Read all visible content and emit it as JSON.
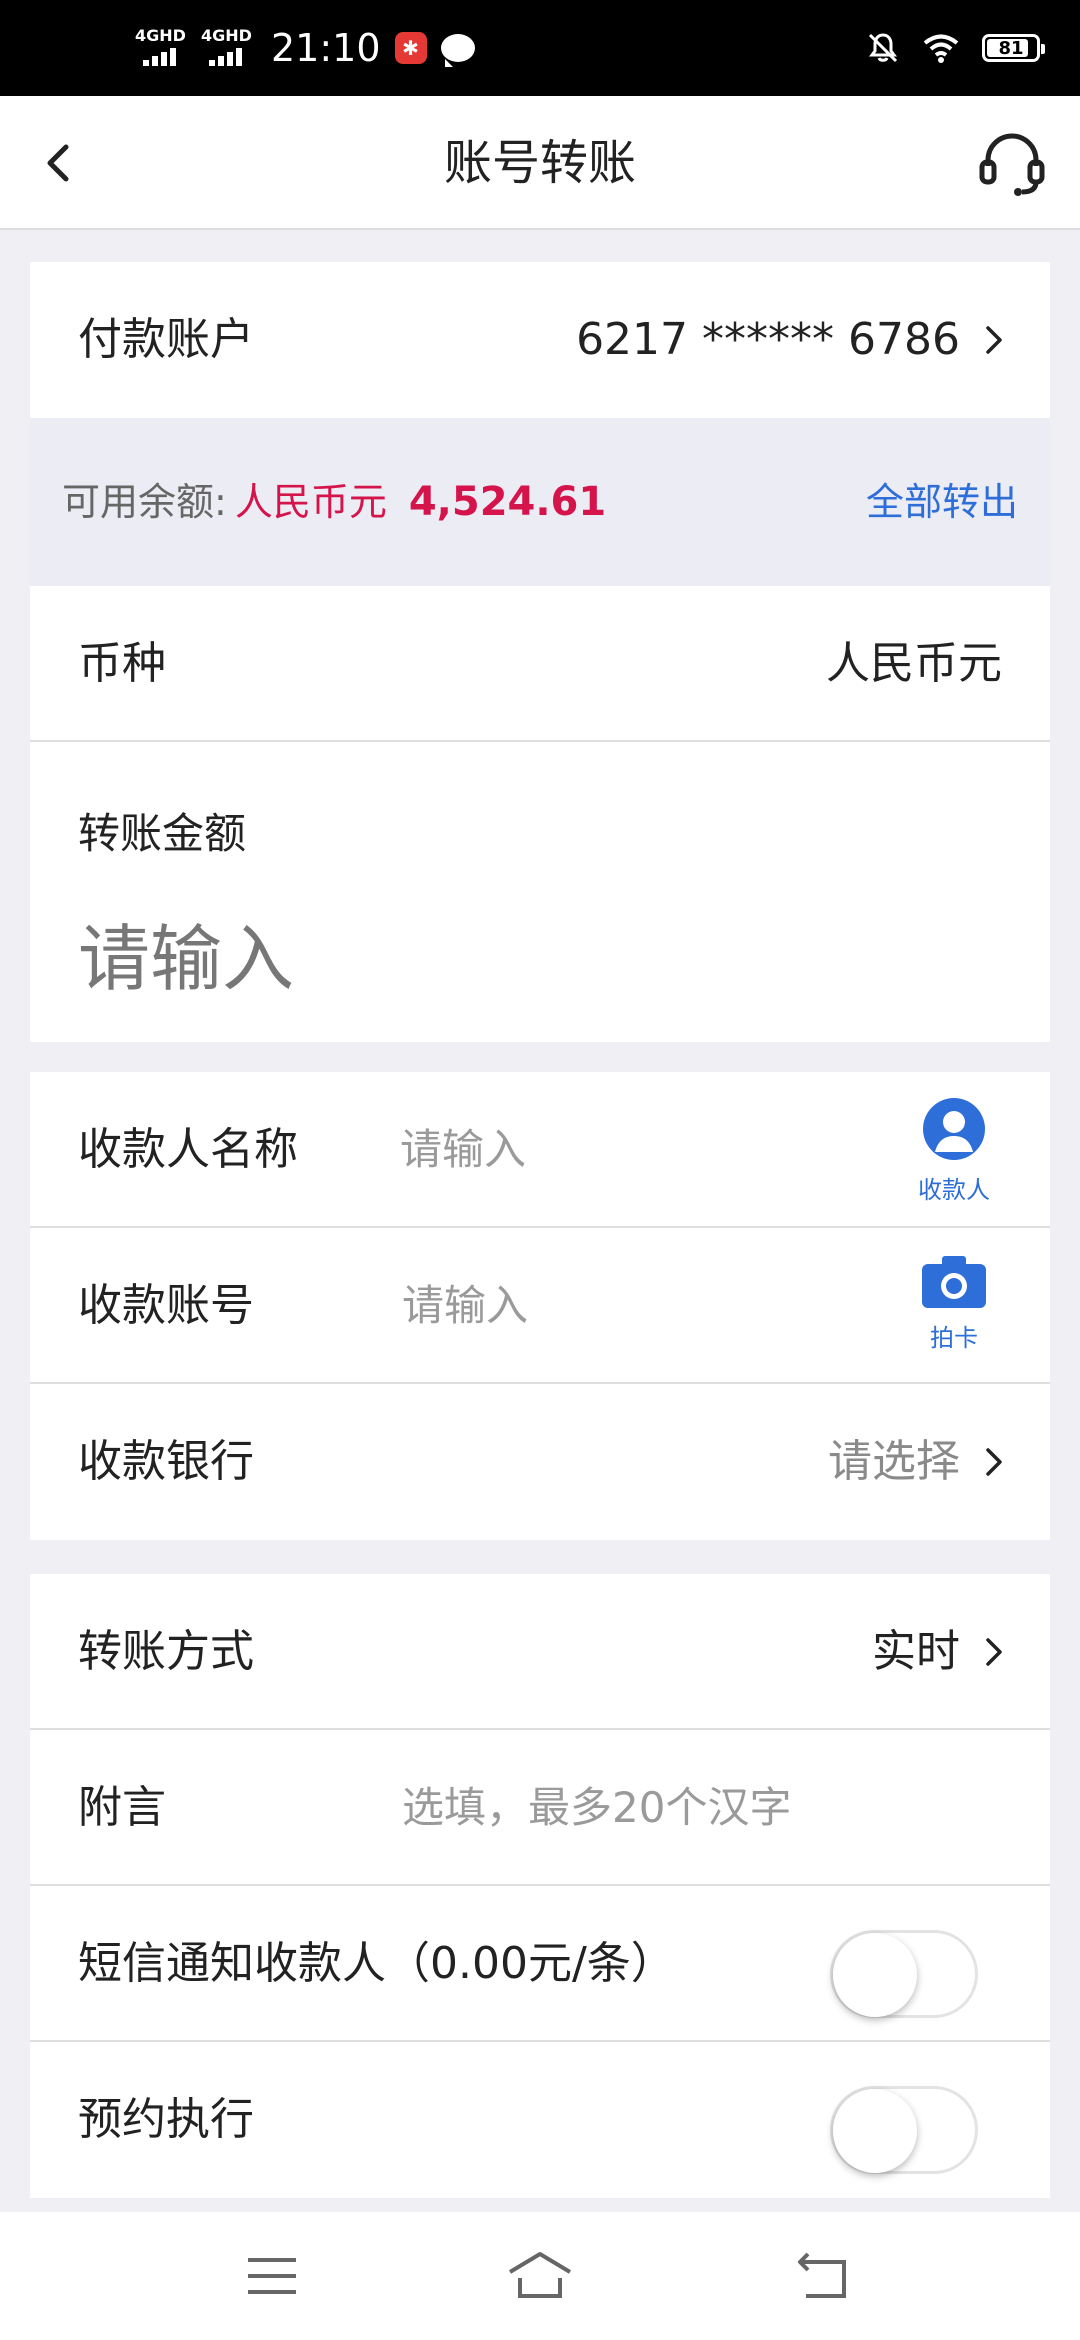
{
  "status_bar": {
    "network_1": "4GHD",
    "network_2": "4GHD",
    "time": "21:10",
    "battery": "81"
  },
  "header": {
    "title": "账号转账"
  },
  "account_card": {
    "label": "付款账户",
    "account_number": "6217 ****** 6786",
    "balance_label": "可用余额:",
    "currency": "人民币元",
    "balance": "4,524.61",
    "transfer_all": "全部转出",
    "currency_label": "币种",
    "currency_value": "人民币元",
    "amount_label": "转账金额",
    "amount_placeholder": "请输入"
  },
  "payee_card": {
    "name_label": "收款人名称",
    "name_placeholder": "请输入",
    "payee_icon_caption": "收款人",
    "account_label": "收款账号",
    "account_placeholder": "请输入",
    "scan_icon_caption": "拍卡",
    "bank_label": "收款银行",
    "bank_value": "请选择"
  },
  "options_card": {
    "method_label": "转账方式",
    "method_value": "实时",
    "note_label": "附言",
    "note_placeholder": "选填，最多20个汉字",
    "sms_label": "短信通知收款人（0.00元/条）",
    "sms_enabled": false,
    "schedule_label": "预约执行",
    "schedule_enabled": false
  },
  "colors": {
    "accent_blue": "#2d6ed8",
    "balance_red": "#d4144b",
    "band_bg": "#ececf4",
    "page_bg": "#efeff4"
  },
  "icons": {
    "back": "chevron-left-icon",
    "service": "headset-icon",
    "payee": "person-icon",
    "scan": "camera-icon",
    "nav_menu": "menu-icon",
    "nav_home": "home-icon",
    "nav_back": "back-icon"
  }
}
